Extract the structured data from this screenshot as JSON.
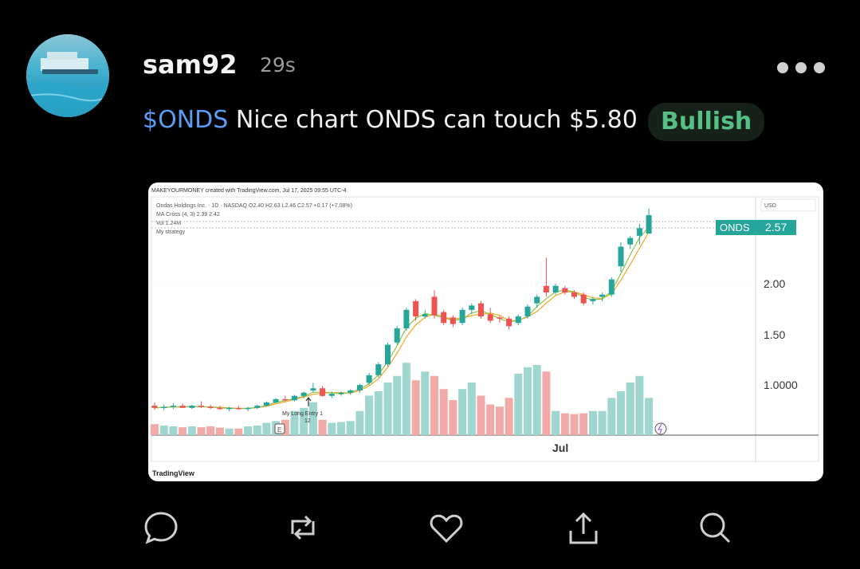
{
  "post": {
    "username": "sam92",
    "time": "29s",
    "ticker": "$ONDS",
    "text": " Nice chart ONDS can touch $5.80",
    "sentiment": "Bullish"
  },
  "chart_image": {
    "header": "MAKEYOURMONEY created with TradingView.com, Jul 17, 2025 09:55 UTC-4",
    "symbol_line": "Ondas Holdings Inc. · 1D · NASDAQ  O2.40  H2.63  L2.46  C2.57  +0.17 (+7.08%)",
    "ma_line": "MA Cross (4, 3)  2.39  2.42",
    "vol_line": "Vol  1.24M",
    "strategy_line": "My strategy",
    "currency": "USD",
    "price_label_symbol": "ONDS",
    "price_label_value": "2.57",
    "price_axis": [
      "2.00",
      "1.50",
      "1.0000"
    ],
    "time_axis": [
      "Jul"
    ],
    "annotation": "My Long Entry 1",
    "annotation_sub": "12",
    "footer": "TradingView",
    "colors": {
      "up": "#26a69a",
      "down": "#ef5350",
      "ma_fast": "#f5a623",
      "ma_slow": "#8bc34a"
    }
  },
  "chart_data": {
    "type": "candlestick",
    "title": "Ondas Holdings Inc. · 1D · NASDAQ",
    "ylabel": "USD",
    "ylim": [
      0.55,
      2.65
    ],
    "x_tick_labels": [
      "Jul"
    ],
    "ohlc": [
      [
        0.82,
        0.85,
        0.78,
        0.8
      ],
      [
        0.8,
        0.83,
        0.78,
        0.81
      ],
      [
        0.81,
        0.84,
        0.79,
        0.82
      ],
      [
        0.82,
        0.84,
        0.8,
        0.8
      ],
      [
        0.8,
        0.83,
        0.79,
        0.82
      ],
      [
        0.82,
        0.86,
        0.8,
        0.81
      ],
      [
        0.81,
        0.83,
        0.79,
        0.8
      ],
      [
        0.8,
        0.82,
        0.78,
        0.79
      ],
      [
        0.79,
        0.81,
        0.77,
        0.8
      ],
      [
        0.8,
        0.82,
        0.78,
        0.79
      ],
      [
        0.79,
        0.81,
        0.77,
        0.8
      ],
      [
        0.8,
        0.83,
        0.79,
        0.82
      ],
      [
        0.82,
        0.86,
        0.81,
        0.85
      ],
      [
        0.85,
        0.89,
        0.84,
        0.88
      ],
      [
        0.88,
        0.91,
        0.86,
        0.87
      ],
      [
        0.87,
        0.92,
        0.86,
        0.91
      ],
      [
        0.91,
        0.95,
        0.89,
        0.94
      ],
      [
        0.96,
        1.03,
        0.94,
        0.98
      ],
      [
        0.98,
        1.0,
        0.9,
        0.91
      ],
      [
        0.91,
        0.95,
        0.89,
        0.93
      ],
      [
        0.93,
        0.95,
        0.91,
        0.94
      ],
      [
        0.94,
        0.97,
        0.92,
        0.96
      ],
      [
        0.96,
        1.02,
        0.94,
        1.01
      ],
      [
        1.03,
        1.12,
        1.01,
        1.1
      ],
      [
        1.1,
        1.22,
        1.08,
        1.2
      ],
      [
        1.2,
        1.4,
        1.18,
        1.38
      ],
      [
        1.4,
        1.55,
        1.38,
        1.53
      ],
      [
        1.53,
        1.72,
        1.51,
        1.7
      ],
      [
        1.78,
        1.8,
        1.6,
        1.64
      ],
      [
        1.64,
        1.7,
        1.62,
        1.66
      ],
      [
        1.82,
        1.88,
        1.62,
        1.65
      ],
      [
        1.68,
        1.7,
        1.56,
        1.58
      ],
      [
        1.63,
        1.65,
        1.54,
        1.57
      ],
      [
        1.58,
        1.72,
        1.56,
        1.7
      ],
      [
        1.7,
        1.76,
        1.66,
        1.74
      ],
      [
        1.76,
        1.78,
        1.62,
        1.64
      ],
      [
        1.66,
        1.72,
        1.58,
        1.6
      ],
      [
        1.63,
        1.65,
        1.58,
        1.62
      ],
      [
        1.62,
        1.64,
        1.52,
        1.55
      ],
      [
        1.58,
        1.66,
        1.56,
        1.64
      ],
      [
        1.64,
        1.75,
        1.62,
        1.73
      ],
      [
        1.76,
        1.84,
        1.72,
        1.82
      ],
      [
        1.92,
        2.18,
        1.82,
        1.86
      ],
      [
        1.86,
        1.94,
        1.84,
        1.92
      ],
      [
        1.9,
        1.92,
        1.84,
        1.86
      ],
      [
        1.86,
        1.88,
        1.8,
        1.82
      ],
      [
        1.84,
        1.86,
        1.74,
        1.76
      ],
      [
        1.78,
        1.82,
        1.75,
        1.8
      ],
      [
        1.82,
        1.86,
        1.78,
        1.84
      ],
      [
        1.84,
        2.0,
        1.82,
        1.98
      ],
      [
        2.1,
        2.32,
        2.05,
        2.28
      ],
      [
        2.3,
        2.38,
        2.26,
        2.36
      ],
      [
        2.38,
        2.49,
        2.3,
        2.45
      ],
      [
        2.4,
        2.63,
        2.46,
        2.57
      ]
    ],
    "volume_relative": [
      0.25,
      0.22,
      0.2,
      0.18,
      0.2,
      0.18,
      0.2,
      0.17,
      0.15,
      0.15,
      0.2,
      0.22,
      0.28,
      0.32,
      0.35,
      0.55,
      0.62,
      0.75,
      0.35,
      0.28,
      0.3,
      0.32,
      0.55,
      0.9,
      1.0,
      1.2,
      1.35,
      1.65,
      1.25,
      1.45,
      1.35,
      1.05,
      0.8,
      1.05,
      1.2,
      0.9,
      0.7,
      0.65,
      0.85,
      1.4,
      1.55,
      1.6,
      1.45,
      0.55,
      0.5,
      0.48,
      0.5,
      0.55,
      0.55,
      0.85,
      1.0,
      1.2,
      1.35,
      0.85
    ]
  }
}
